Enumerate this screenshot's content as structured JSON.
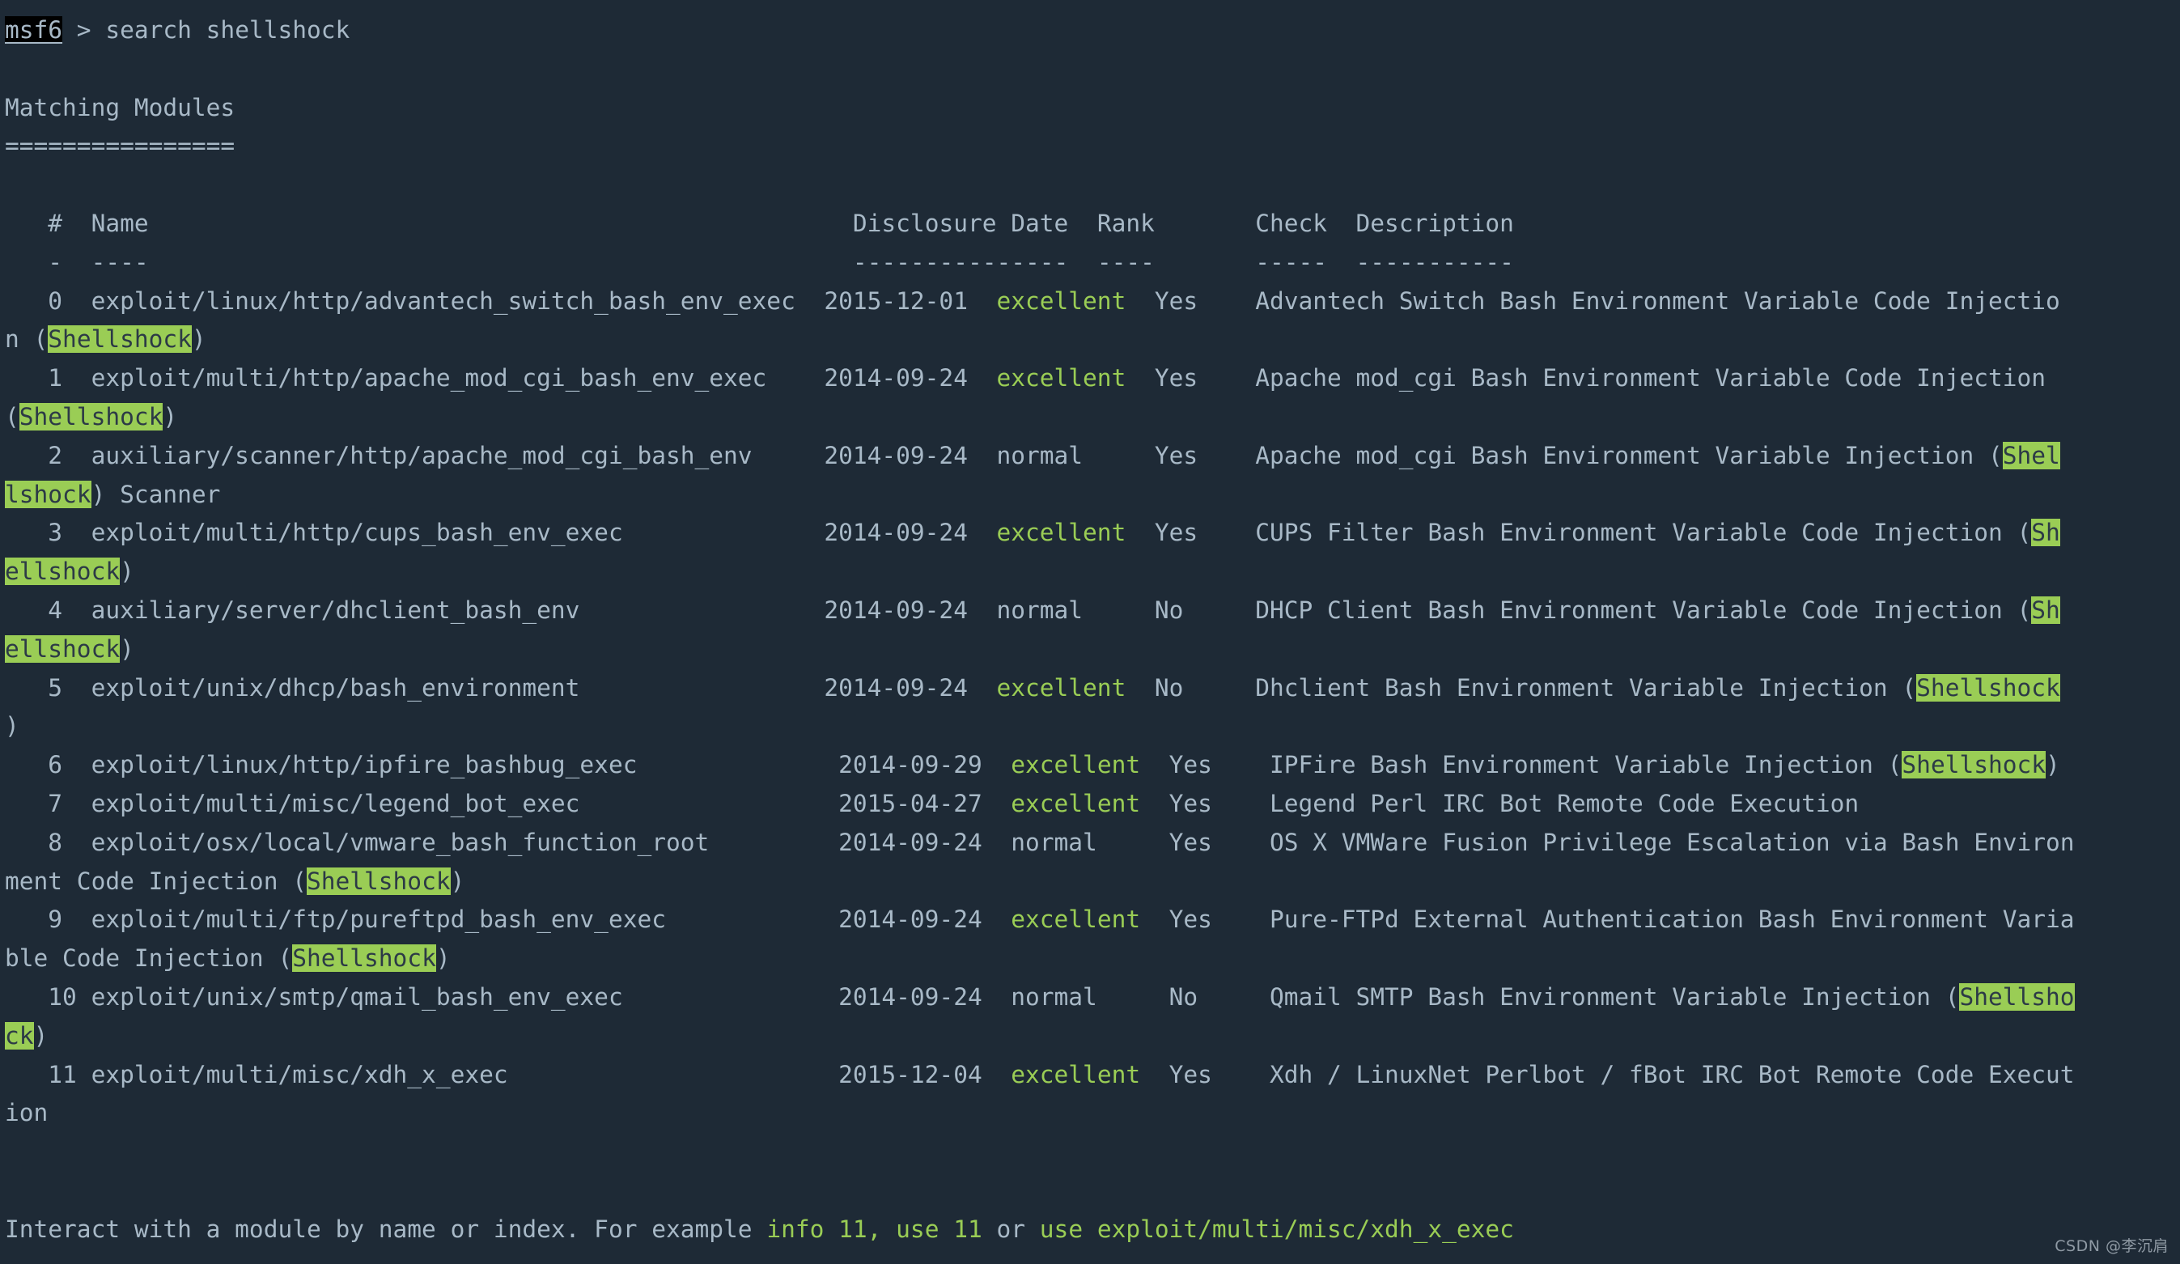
{
  "terminal": {
    "background_color": "#1e2a36",
    "foreground_color": "#a8b9c7",
    "accent_green": "#9acd55",
    "prompt": {
      "host": "msf6",
      "separator": " > ",
      "command": "search shellshock"
    },
    "section_title": "Matching Modules",
    "section_underline": "================",
    "columns": {
      "index": "#",
      "name": "Name",
      "disclosure_date": "Disclosure Date",
      "rank": "Rank",
      "check": "Check",
      "description": "Description"
    },
    "column_rules": {
      "index": "-",
      "name": "----",
      "disclosure_date": "---------------",
      "rank": "----",
      "check": "-----",
      "description": "-----------"
    },
    "footer": {
      "prefix": "Interact with a module by name or index. For example ",
      "cmd1": "info 11,",
      "mid1": " ",
      "cmd2": "use 11",
      "mid2": " or ",
      "cmd3": "use exploit/multi/misc/xdh_x_exec"
    },
    "watermark": "CSDN @李沉肩"
  },
  "rows": [
    {
      "index": "0",
      "name": "exploit/linux/http/advantech_switch_bash_env_exec",
      "disclosure_date": "2015-12-01",
      "rank": "excellent",
      "rank_color": "green",
      "check": "Yes",
      "description": "Advantech Switch Bash Environment Variable Code Injection (Shellshock)",
      "line1_pre": "   0  exploit/linux/http/advantech_switch_bash_env_exec  2015-12-01  ",
      "line1_rank": "excellent",
      "line1_mid": "  Yes    Advantech Switch Bash Environment Variable Code Injectio",
      "line2_pre": "n (",
      "line2_hl": "Shellshock",
      "line2_post": ")"
    },
    {
      "index": "1",
      "name": "exploit/multi/http/apache_mod_cgi_bash_env_exec",
      "disclosure_date": "2014-09-24",
      "rank": "excellent",
      "rank_color": "green",
      "check": "Yes",
      "description": "Apache mod_cgi Bash Environment Variable Code Injection (Shellshock)",
      "line1_pre": "   1  exploit/multi/http/apache_mod_cgi_bash_env_exec    2014-09-24  ",
      "line1_rank": "excellent",
      "line1_mid": "  Yes    Apache mod_cgi Bash Environment Variable Code Injection ",
      "line2_pre": "(",
      "line2_hl": "Shellshock",
      "line2_post": ")"
    },
    {
      "index": "2",
      "name": "auxiliary/scanner/http/apache_mod_cgi_bash_env",
      "disclosure_date": "2014-09-24",
      "rank": "normal",
      "rank_color": "plain",
      "check": "Yes",
      "description": "Apache mod_cgi Bash Environment Variable Injection (Shellshock) Scanner",
      "line1_pre": "   2  auxiliary/scanner/http/apache_mod_cgi_bash_env     2014-09-24  ",
      "line1_rank": "normal",
      "line1_mid": "     Yes    Apache mod_cgi Bash Environment Variable Injection (",
      "line1_hl_tail": "Shel",
      "line2_hl": "lshock",
      "line2_post": ") Scanner"
    },
    {
      "index": "3",
      "name": "exploit/multi/http/cups_bash_env_exec",
      "disclosure_date": "2014-09-24",
      "rank": "excellent",
      "rank_color": "green",
      "check": "Yes",
      "description": "CUPS Filter Bash Environment Variable Code Injection (Shellshock)",
      "line1_pre": "   3  exploit/multi/http/cups_bash_env_exec              2014-09-24  ",
      "line1_rank": "excellent",
      "line1_mid": "  Yes    CUPS Filter Bash Environment Variable Code Injection (",
      "line1_hl_tail": "Sh",
      "line2_hl": "ellshock",
      "line2_post": ")"
    },
    {
      "index": "4",
      "name": "auxiliary/server/dhclient_bash_env",
      "disclosure_date": "2014-09-24",
      "rank": "normal",
      "rank_color": "plain",
      "check": "No",
      "description": "DHCP Client Bash Environment Variable Code Injection (Shellshock)",
      "line1_pre": "   4  auxiliary/server/dhclient_bash_env                 2014-09-24  ",
      "line1_rank": "normal",
      "line1_mid": "     No     DHCP Client Bash Environment Variable Code Injection (",
      "line1_hl_tail": "Sh",
      "line2_hl": "ellshock",
      "line2_post": ")"
    },
    {
      "index": "5",
      "name": "exploit/unix/dhcp/bash_environment",
      "disclosure_date": "2014-09-24",
      "rank": "excellent",
      "rank_color": "green",
      "check": "No",
      "description": "Dhclient Bash Environment Variable Injection (Shellshock)",
      "line1_pre": "   5  exploit/unix/dhcp/bash_environment                 2014-09-24  ",
      "line1_rank": "excellent",
      "line1_mid": "  No     Dhclient Bash Environment Variable Injection (",
      "line1_hl_tail": "Shellshock",
      "line2_hl": "",
      "line2_post": ")"
    },
    {
      "index": "6",
      "name": "exploit/linux/http/ipfire_bashbug_exec",
      "disclosure_date": "2014-09-29",
      "rank": "excellent",
      "rank_color": "green",
      "check": "Yes",
      "description": "IPFire Bash Environment Variable Injection (Shellshock)",
      "line1_pre": "   6  exploit/linux/http/ipfire_bashbug_exec              2014-09-29  ",
      "line1_rank": "excellent",
      "line1_mid": "  Yes    IPFire Bash Environment Variable Injection (",
      "line1_hl_tail": "Shellshock",
      "line1_tail_post": ")"
    },
    {
      "index": "7",
      "name": "exploit/multi/misc/legend_bot_exec",
      "disclosure_date": "2015-04-27",
      "rank": "excellent",
      "rank_color": "green",
      "check": "Yes",
      "description": "Legend Perl IRC Bot Remote Code Execution",
      "line1_pre": "   7  exploit/multi/misc/legend_bot_exec                  2015-04-27  ",
      "line1_rank": "excellent",
      "line1_mid": "  Yes    Legend Perl IRC Bot Remote Code Execution"
    },
    {
      "index": "8",
      "name": "exploit/osx/local/vmware_bash_function_root",
      "disclosure_date": "2014-09-24",
      "rank": "normal",
      "rank_color": "plain",
      "check": "Yes",
      "description": "OS X VMWare Fusion Privilege Escalation via Bash Environment Code Injection (Shellshock)",
      "line1_pre": "   8  exploit/osx/local/vmware_bash_function_root         2014-09-24  ",
      "line1_rank": "normal",
      "line1_mid": "     Yes    OS X VMWare Fusion Privilege Escalation via Bash Environ",
      "line2_pre": "ment Code Injection (",
      "line2_hl": "Shellshock",
      "line2_post": ")"
    },
    {
      "index": "9",
      "name": "exploit/multi/ftp/pureftpd_bash_env_exec",
      "disclosure_date": "2014-09-24",
      "rank": "excellent",
      "rank_color": "green",
      "check": "Yes",
      "description": "Pure-FTPd External Authentication Bash Environment Variable Code Injection (Shellshock)",
      "line1_pre": "   9  exploit/multi/ftp/pureftpd_bash_env_exec            2014-09-24  ",
      "line1_rank": "excellent",
      "line1_mid": "  Yes    Pure-FTPd External Authentication Bash Environment Varia",
      "line2_pre": "ble Code Injection (",
      "line2_hl": "Shellshock",
      "line2_post": ")"
    },
    {
      "index": "10",
      "name": "exploit/unix/smtp/qmail_bash_env_exec",
      "disclosure_date": "2014-09-24",
      "rank": "normal",
      "rank_color": "plain",
      "check": "No",
      "description": "Qmail SMTP Bash Environment Variable Injection (Shellshock)",
      "line1_pre": "   10 exploit/unix/smtp/qmail_bash_env_exec               2014-09-24  ",
      "line1_rank": "normal",
      "line1_mid": "     No     Qmail SMTP Bash Environment Variable Injection (",
      "line1_hl_tail": "Shellsho",
      "line2_hl": "ck",
      "line2_post": ")"
    },
    {
      "index": "11",
      "name": "exploit/multi/misc/xdh_x_exec",
      "disclosure_date": "2015-12-04",
      "rank": "excellent",
      "rank_color": "green",
      "check": "Yes",
      "description": "Xdh / LinuxNet Perlbot / fBot IRC Bot Remote Code Execution",
      "line1_pre": "   11 exploit/multi/misc/xdh_x_exec                       2015-12-04  ",
      "line1_rank": "excellent",
      "line1_mid": "  Yes    Xdh / LinuxNet Perlbot / fBot IRC Bot Remote Code Execut",
      "line2_pre": "ion"
    }
  ]
}
